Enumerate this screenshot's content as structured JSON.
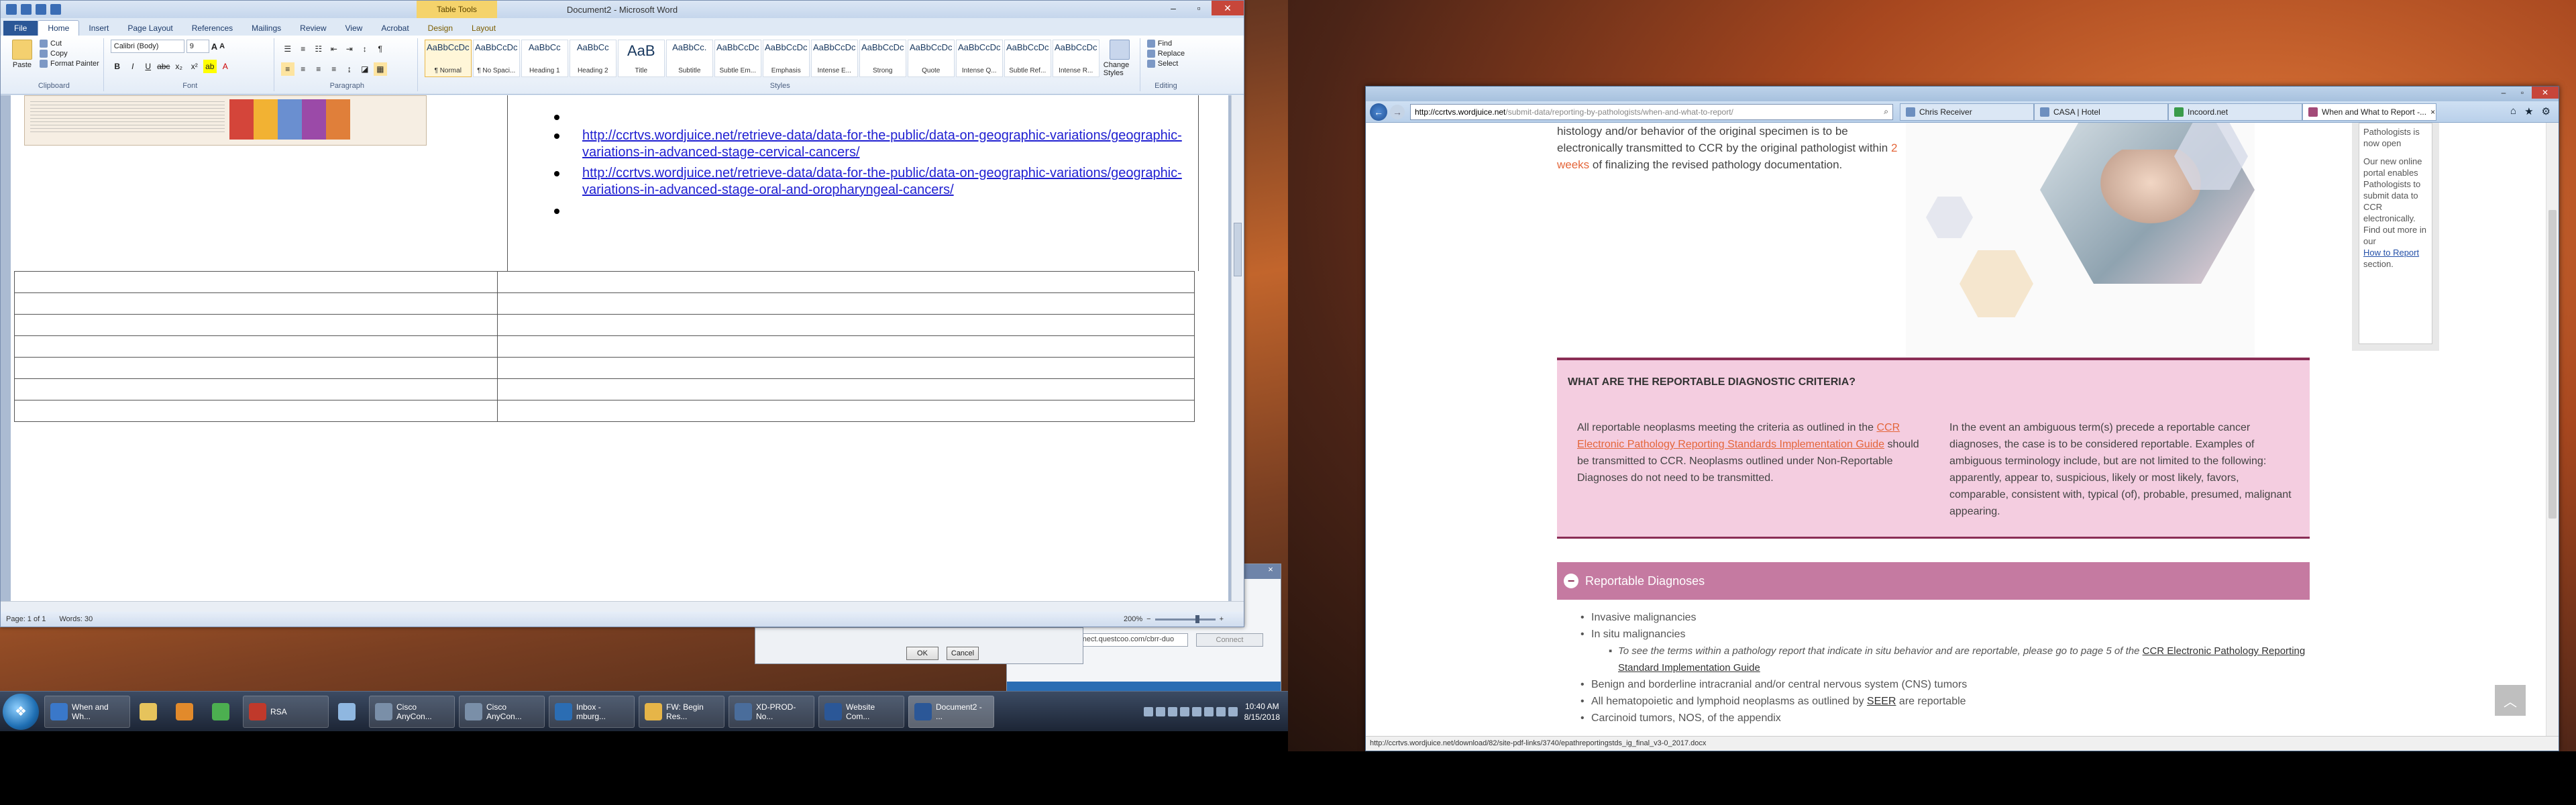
{
  "word": {
    "title": "Document2 - Microsoft Word",
    "context_tab_group": "Table Tools",
    "tabs": [
      "File",
      "Home",
      "Insert",
      "Page Layout",
      "References",
      "Mailings",
      "Review",
      "View",
      "Acrobat",
      "Design",
      "Layout"
    ],
    "clipboard": {
      "paste": "Paste",
      "cut": "Cut",
      "copy": "Copy",
      "format_painter": "Format Painter",
      "group": "Clipboard"
    },
    "font": {
      "name": "Calibri (Body)",
      "size": "9",
      "group": "Font"
    },
    "paragraph_group": "Paragraph",
    "styles": [
      {
        "preview": "AaBbCcDc",
        "name": "¶ Normal"
      },
      {
        "preview": "AaBbCcDc",
        "name": "¶ No Spaci..."
      },
      {
        "preview": "AaBbCc",
        "name": "Heading 1"
      },
      {
        "preview": "AaBbCc",
        "name": "Heading 2"
      },
      {
        "preview": "AaB",
        "name": "Title"
      },
      {
        "preview": "AaBbCc.",
        "name": "Subtitle"
      },
      {
        "preview": "AaBbCcDc",
        "name": "Subtle Em..."
      },
      {
        "preview": "AaBbCcDc",
        "name": "Emphasis"
      },
      {
        "preview": "AaBbCcDc",
        "name": "Intense E..."
      },
      {
        "preview": "AaBbCcDc",
        "name": "Strong"
      },
      {
        "preview": "AaBbCcDc",
        "name": "Quote"
      },
      {
        "preview": "AaBbCcDc",
        "name": "Intense Q..."
      },
      {
        "preview": "AaBbCcDc",
        "name": "Subtle Ref..."
      },
      {
        "preview": "AaBbCcDc",
        "name": "Intense R..."
      }
    ],
    "styles_group": "Styles",
    "change_styles": "Change Styles",
    "editing": {
      "find": "Find",
      "replace": "Replace",
      "select": "Select",
      "group": "Editing"
    },
    "links": [
      "http://ccrtvs.wordjuice.net/retrieve-data/data-for-the-public/data-on-geographic-variations/geographic-variations-in-advanced-stage-cervical-cancers/",
      "http://ccrtvs.wordjuice.net/retrieve-data/data-for-the-public/data-on-geographic-variations/geographic-variations-in-advanced-stage-oral-and-oropharyngeal-cancers/"
    ],
    "status": {
      "page": "Page: 1 of 1",
      "words": "Words: 30",
      "zoom": "200%"
    }
  },
  "dialog": {
    "ok": "OK",
    "cancel": "Cancel"
  },
  "anyconnect": {
    "server": "connect.questcoo.com/cbrr-duo",
    "connect": "Connect"
  },
  "taskbar": {
    "items": [
      {
        "label": "When and Wh...",
        "icon": "ie-icon",
        "color": "#3a78c9"
      },
      {
        "label": "",
        "icon": "folder-icon",
        "color": "#e6c35c"
      },
      {
        "label": "",
        "icon": "media-player-icon",
        "color": "#e28a2b"
      },
      {
        "label": "",
        "icon": "chrome-icon",
        "color": "#4caf50"
      },
      {
        "label": "RSA",
        "icon": "rsa-icon",
        "color": "#c0392b"
      },
      {
        "label": "",
        "icon": "pen-icon",
        "color": "#8fb7e0"
      },
      {
        "label": "Cisco AnyCon...",
        "icon": "cisco-icon",
        "color": "#7a8fa8"
      },
      {
        "label": "Cisco AnyCon...",
        "icon": "cisco-icon",
        "color": "#7a8fa8"
      },
      {
        "label": "Inbox - mburg...",
        "icon": "outlook-icon",
        "color": "#2b6db3"
      },
      {
        "label": "FW: Begin Res...",
        "icon": "mail-icon",
        "color": "#e6b548"
      },
      {
        "label": "XD-PROD-No...",
        "icon": "remote-icon",
        "color": "#4a6d9b"
      },
      {
        "label": "Website Com...",
        "icon": "word-icon",
        "color": "#2b5797"
      },
      {
        "label": "Document2 - ...",
        "icon": "word-icon",
        "color": "#2b5797"
      }
    ],
    "time": "10:40 AM",
    "date": "8/15/2018"
  },
  "ie": {
    "address_domain": "http://ccrtvs.wordjuice.net",
    "address_path": "/submit-data/reporting-by-pathologists/when-and-what-to-report/",
    "tabs": [
      "Chris Receiver",
      "CASA | Hotel",
      "Incoord.net",
      "When and What to Report -..."
    ],
    "top_para_before": "histology and/or behavior of the original specimen is to be electronically transmitted to CCR by the original pathologist within ",
    "top_para_hl": "2 weeks",
    "top_para_after": " of finalizing the revised pathology documentation.",
    "side_note": {
      "head": "Pathologists is now open",
      "body": "Our new online portal enables Pathologists to submit data to CCR electronically. Find out more in our",
      "link": "How to Report",
      "tail": "section."
    },
    "question": "WHAT ARE THE REPORTABLE DIAGNOSTIC CRITERIA?",
    "col1_before": "All reportable neoplasms meeting the criteria as outlined in the ",
    "col1_link": "CCR Electronic Pathology Reporting Standards Implementation Guide",
    "col1_after": " should be transmitted to CCR. Neoplasms outlined under Non-Reportable Diagnoses do not need to be transmitted.",
    "col2": "In the event an ambiguous term(s) precede a reportable cancer diagnoses, the case is to be considered reportable. Examples of ambiguous terminology include, but are not limited to the following: apparently, appear to, suspicious, likely or most likely, favors, comparable, consistent with, typical (of), probable, presumed, malignant appearing.",
    "accordion": "Reportable Diagnoses",
    "list": {
      "i1": "Invasive malignancies",
      "i2": "In situ malignancies",
      "sub_before": "To see the terms within a pathology report that indicate in situ behavior and are reportable, please go to page 5 of the ",
      "sub_link": "CCR Electronic Pathology Reporting Standard Implementation Guide",
      "i3": "Benign and borderline intracranial and/or central nervous system (CNS) tumors",
      "i4_before": "All hematopoietic and lymphoid neoplasms as outlined by ",
      "i4_link": "SEER",
      "i4_after": " are reportable",
      "i5": "Carcinoid tumors, NOS, of the appendix"
    },
    "status_url": "http://ccrtvs.wordjuice.net/download/82/site-pdf-links/3740/epathreportingstds_ig_final_v3-0_2017.docx"
  }
}
